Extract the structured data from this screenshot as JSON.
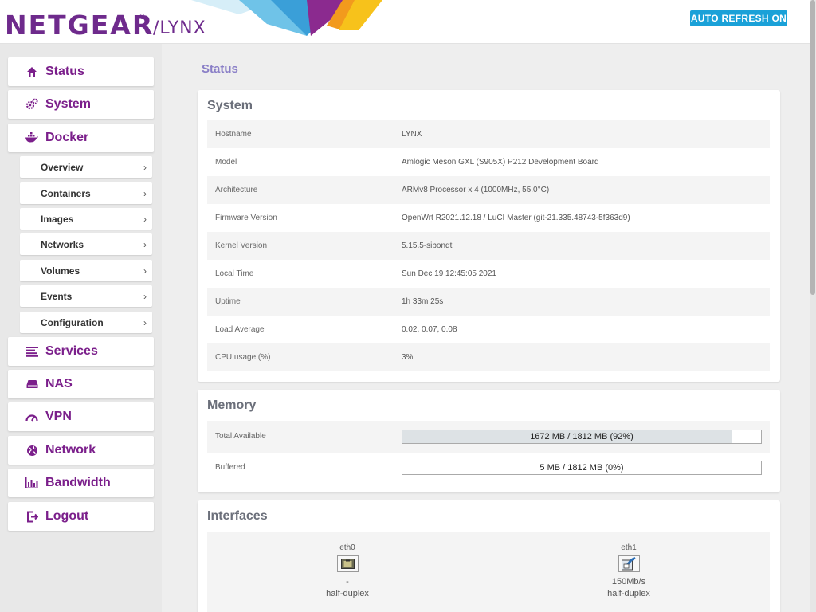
{
  "header": {
    "logo_text": "NETGEAR",
    "logo_reg": "®",
    "logo_sub": "./LYNX",
    "auto_refresh_label": "AUTO REFRESH ON"
  },
  "colors": {
    "brand_purple": "#7b1f8b",
    "accent_blue": "#1aa1d8",
    "title_lavender": "#8a7fc7"
  },
  "sidebar": {
    "items": [
      {
        "label": "Status",
        "icon": "home-icon"
      },
      {
        "label": "System",
        "icon": "gears-icon"
      },
      {
        "label": "Docker",
        "icon": "docker-icon"
      }
    ],
    "docker_sub": [
      {
        "label": "Overview",
        "chevron": "›"
      },
      {
        "label": "Containers",
        "chevron": "›"
      },
      {
        "label": "Images",
        "chevron": "›"
      },
      {
        "label": "Networks",
        "chevron": "›"
      },
      {
        "label": "Volumes",
        "chevron": "›"
      },
      {
        "label": "Events",
        "chevron": "›"
      },
      {
        "label": "Configuration",
        "chevron": "›"
      }
    ],
    "items_after": [
      {
        "label": "Services",
        "icon": "list-icon"
      },
      {
        "label": "NAS",
        "icon": "drive-icon"
      },
      {
        "label": "VPN",
        "icon": "gauge-icon"
      },
      {
        "label": "Network",
        "icon": "globe-icon"
      },
      {
        "label": "Bandwidth",
        "icon": "bar-chart-icon"
      },
      {
        "label": "Logout",
        "icon": "logout-icon"
      }
    ]
  },
  "main": {
    "page_title": "Status",
    "system": {
      "title": "System",
      "rows": [
        {
          "key": "Hostname",
          "value": "LYNX"
        },
        {
          "key": "Model",
          "value": "Amlogic Meson GXL (S905X) P212 Development Board"
        },
        {
          "key": "Architecture",
          "value": "ARMv8 Processor x 4 (1000MHz, 55.0°C)"
        },
        {
          "key": "Firmware Version",
          "value": "OpenWrt R2021.12.18 / LuCI Master (git-21.335.48743-5f363d9)"
        },
        {
          "key": "Kernel Version",
          "value": "5.15.5-sibondt"
        },
        {
          "key": "Local Time",
          "value": "Sun Dec 19 12:45:05 2021"
        },
        {
          "key": "Uptime",
          "value": "1h 33m 25s"
        },
        {
          "key": "Load Average",
          "value": "0.02, 0.07, 0.08"
        },
        {
          "key": "CPU usage (%)",
          "value": "3%"
        }
      ]
    },
    "memory": {
      "title": "Memory",
      "rows": [
        {
          "key": "Total Available",
          "text": "1672 MB / 1812 MB (92%)",
          "fraction": 0.92
        },
        {
          "key": "Buffered",
          "text": "5 MB / 1812 MB (0%)",
          "fraction": 0.0
        }
      ]
    },
    "interfaces": {
      "title": "Interfaces",
      "items": [
        {
          "name": "eth0",
          "speed": "-",
          "duplex": "half-duplex",
          "icon": "ethernet-port-icon"
        },
        {
          "name": "eth1",
          "speed": "150Mb/s",
          "duplex": "half-duplex",
          "icon": "ethernet-connected-icon"
        }
      ]
    }
  }
}
